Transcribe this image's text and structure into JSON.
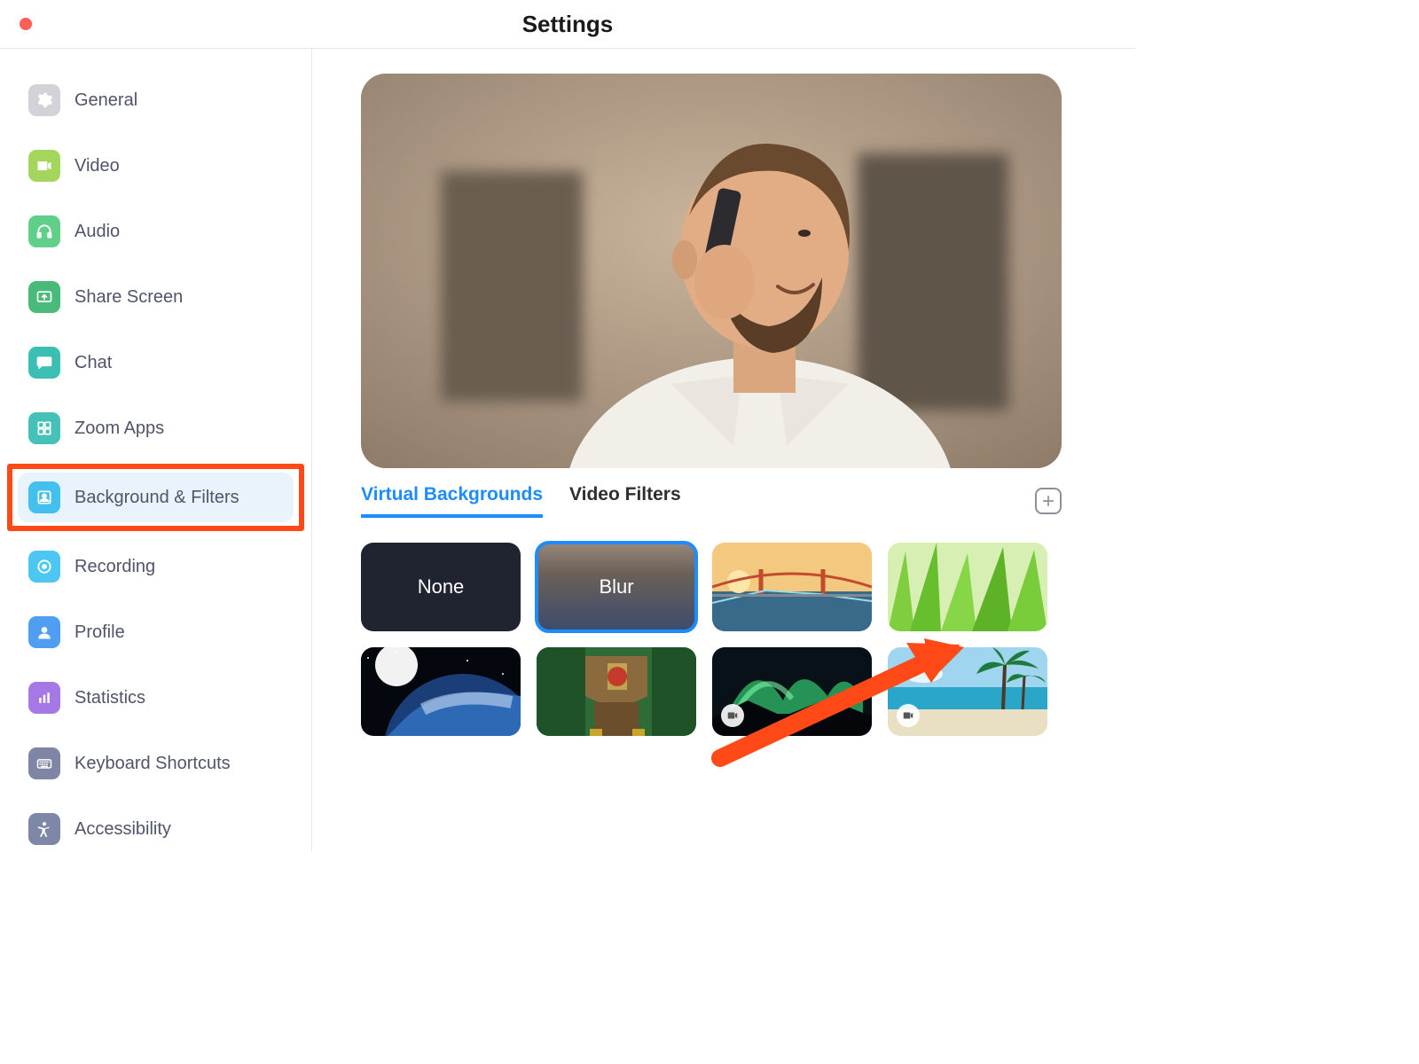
{
  "window": {
    "title": "Settings"
  },
  "sidebar": {
    "items": [
      {
        "label": "General",
        "icon": "gear-icon",
        "color": "#d2d2d8"
      },
      {
        "label": "Video",
        "icon": "video-icon",
        "color": "#a4d65e"
      },
      {
        "label": "Audio",
        "icon": "headphones-icon",
        "color": "#5fcf8a"
      },
      {
        "label": "Share Screen",
        "icon": "share-screen-icon",
        "color": "#4aba7a"
      },
      {
        "label": "Chat",
        "icon": "chat-icon",
        "color": "#3bbfb2"
      },
      {
        "label": "Zoom Apps",
        "icon": "apps-icon",
        "color": "#45c1b7"
      },
      {
        "label": "Background & Filters",
        "icon": "background-icon",
        "color": "#43c0ed",
        "active": true,
        "highlighted": true
      },
      {
        "label": "Recording",
        "icon": "record-icon",
        "color": "#4cc7f3"
      },
      {
        "label": "Profile",
        "icon": "profile-icon",
        "color": "#4f9ef2"
      },
      {
        "label": "Statistics",
        "icon": "stats-icon",
        "color": "#a578e6"
      },
      {
        "label": "Keyboard Shortcuts",
        "icon": "keyboard-icon",
        "color": "#7e85a5"
      },
      {
        "label": "Accessibility",
        "icon": "accessibility-icon",
        "color": "#7f87a8"
      }
    ]
  },
  "tabs": {
    "items": [
      {
        "label": "Virtual Backgrounds",
        "active": true
      },
      {
        "label": "Video Filters",
        "active": false
      }
    ],
    "add_tooltip": "Add"
  },
  "backgrounds": [
    {
      "kind": "none",
      "label": "None"
    },
    {
      "kind": "blur",
      "label": "Blur",
      "selected": true
    },
    {
      "kind": "image",
      "name": "golden-gate-bridge"
    },
    {
      "kind": "image",
      "name": "grass"
    },
    {
      "kind": "image",
      "name": "earth-from-space"
    },
    {
      "kind": "image",
      "name": "jurassic-park"
    },
    {
      "kind": "video",
      "name": "northern-lights"
    },
    {
      "kind": "video",
      "name": "tropical-beach"
    }
  ],
  "annotation": {
    "arrow_target": "blur"
  }
}
